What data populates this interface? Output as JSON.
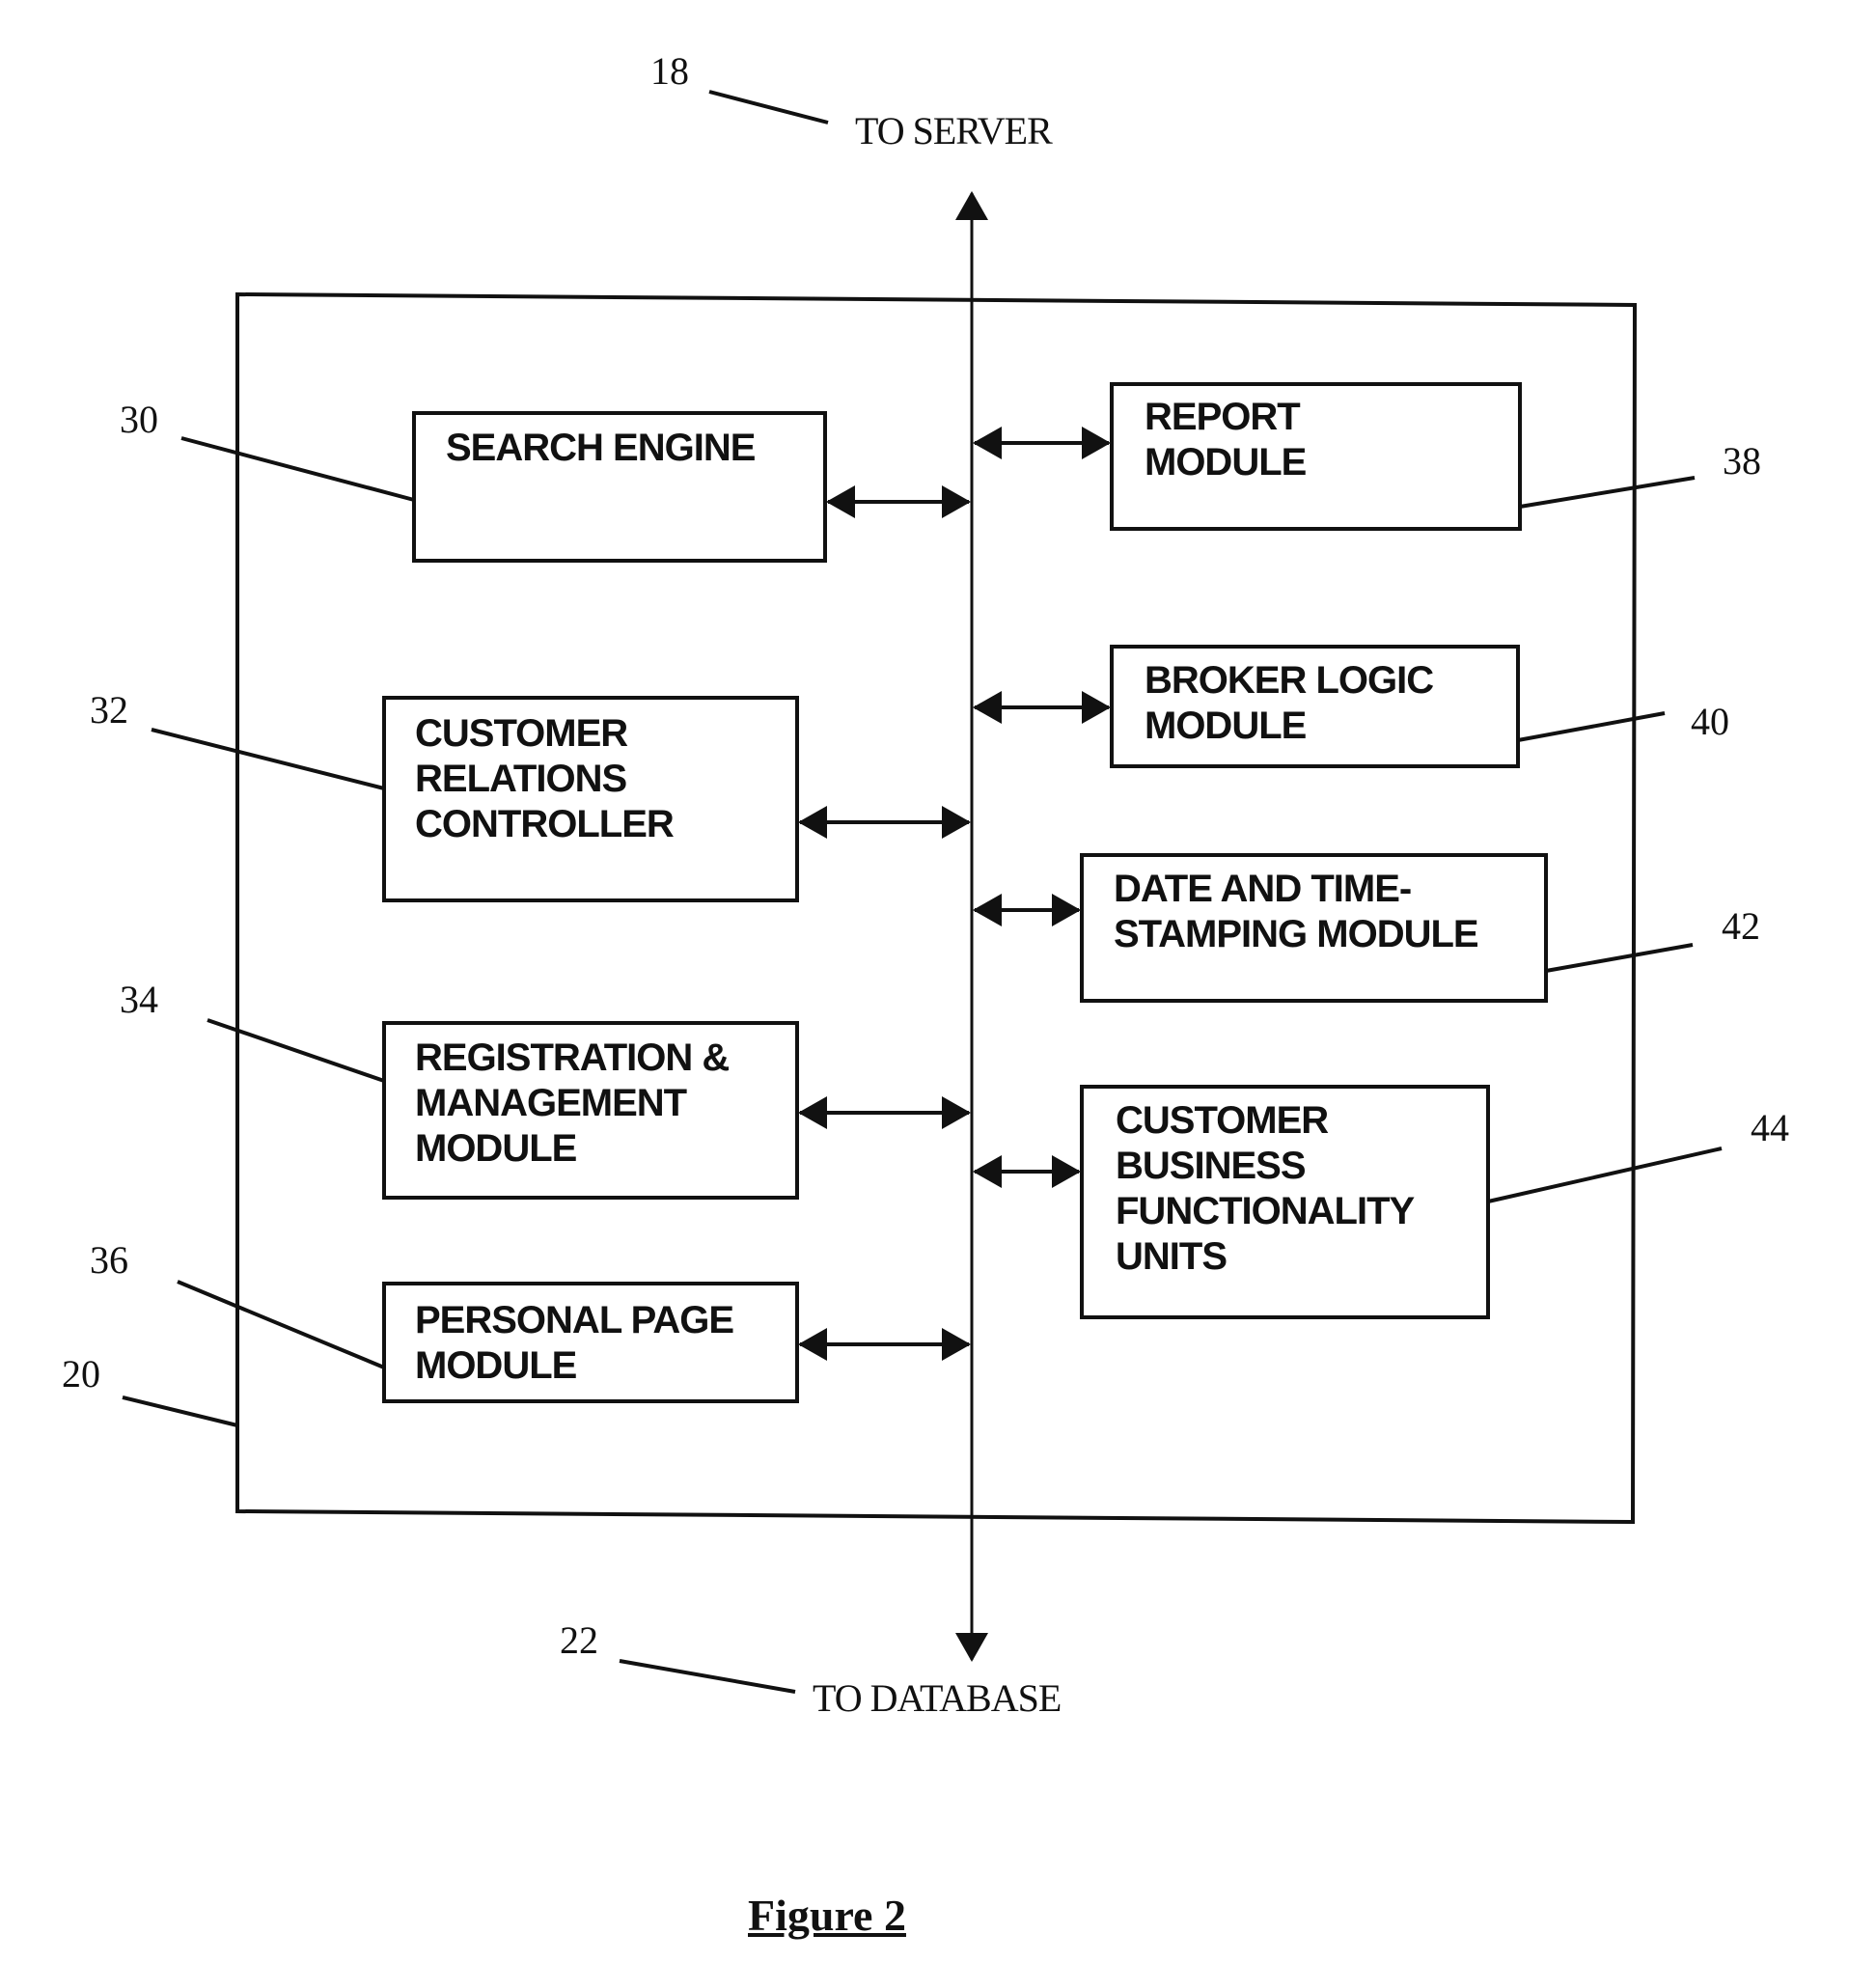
{
  "diagram": {
    "top_endpoint": {
      "label": "TO SERVER",
      "ref": "18"
    },
    "bottom_endpoint": {
      "label": "TO DATABASE",
      "ref": "22"
    },
    "container": {
      "ref": "20"
    },
    "modules_left": [
      {
        "label": "SEARCH ENGINE",
        "ref": "30"
      },
      {
        "label": "CUSTOMER\nRELATIONS\nCONTROLLER",
        "ref": "32"
      },
      {
        "label": "REGISTRATION &\nMANAGEMENT\nMODULE",
        "ref": "34"
      },
      {
        "label": "PERSONAL PAGE\nMODULE",
        "ref": "36"
      }
    ],
    "modules_right": [
      {
        "label": "REPORT\nMODULE",
        "ref": "38"
      },
      {
        "label": "BROKER LOGIC\nMODULE",
        "ref": "40"
      },
      {
        "label": "DATE AND TIME-\nSTAMPING MODULE",
        "ref": "42"
      },
      {
        "label": "CUSTOMER\nBUSINESS\nFUNCTIONALITY\nUNITS",
        "ref": "44"
      }
    ],
    "caption": "Figure 2"
  }
}
